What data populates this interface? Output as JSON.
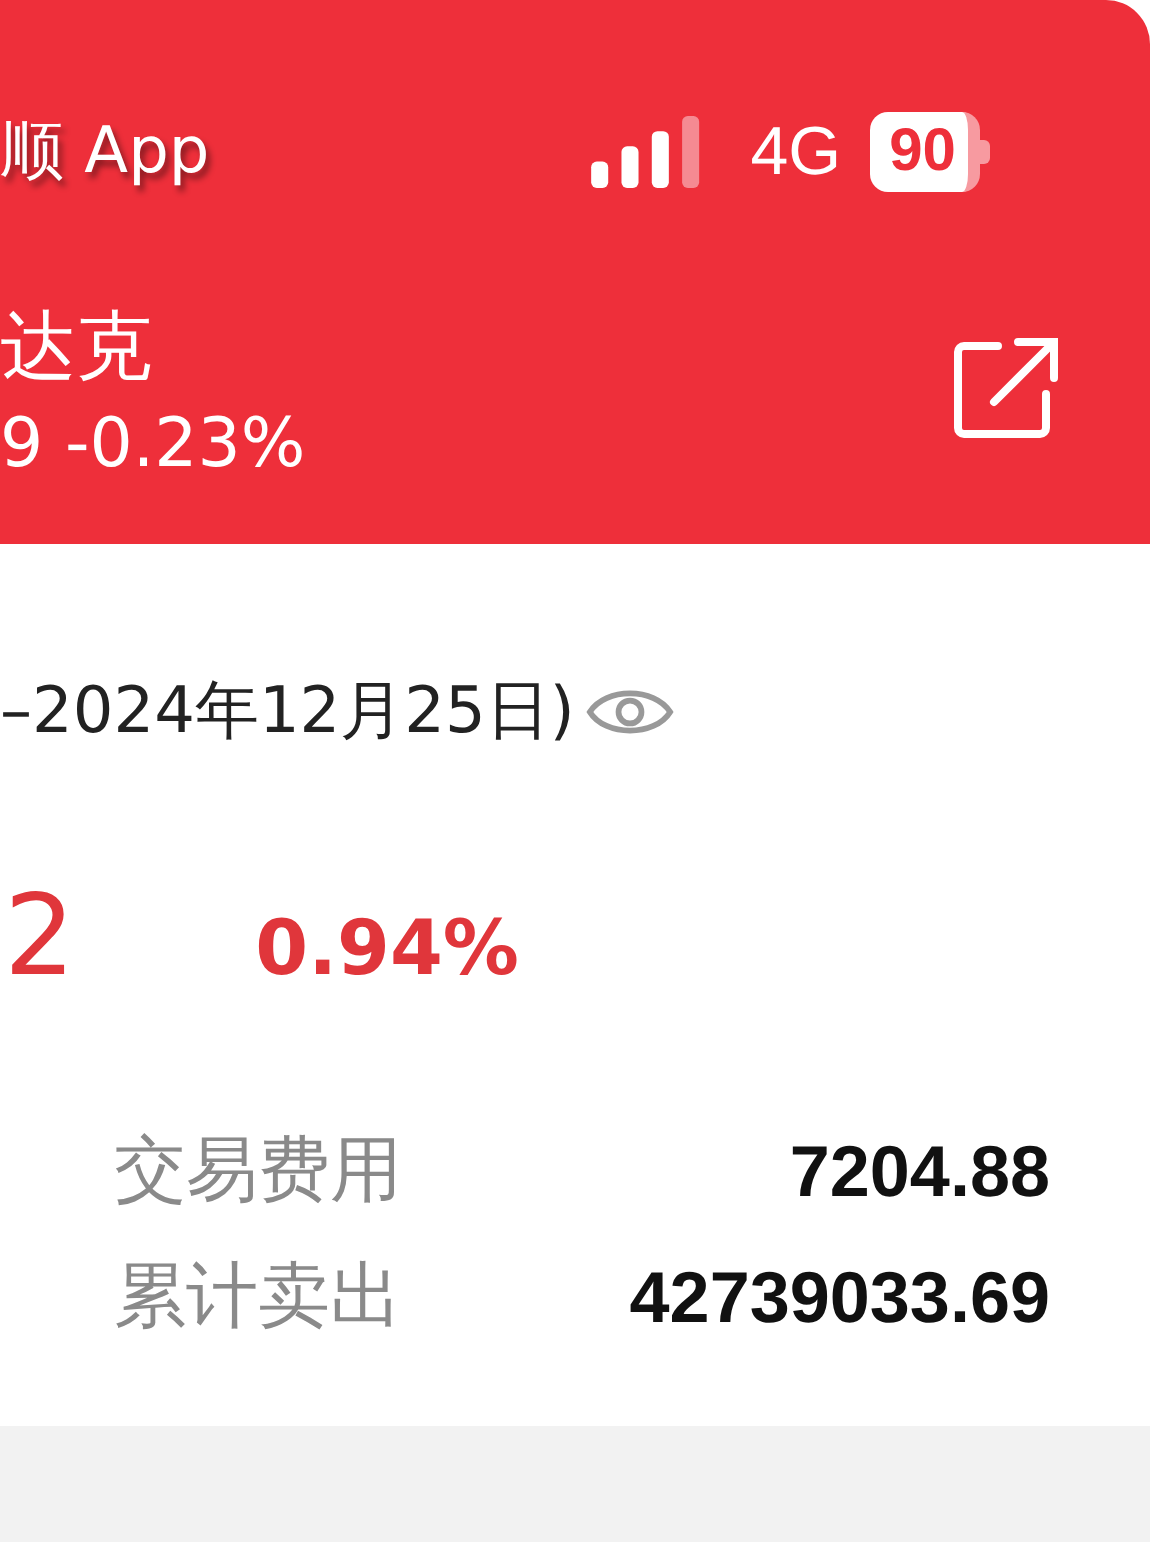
{
  "status_bar": {
    "back_app": "顺 App",
    "network": "4G",
    "battery": "90"
  },
  "header": {
    "title": "达克",
    "quote": "9 -0.23%"
  },
  "period": {
    "text": "–2024年12月25日)"
  },
  "summary": {
    "value": "2",
    "rate": "0.94%"
  },
  "stats": [
    {
      "label": "交易费用",
      "value": "7204.88"
    },
    {
      "label": "累计卖出",
      "value": "42739033.69"
    }
  ]
}
